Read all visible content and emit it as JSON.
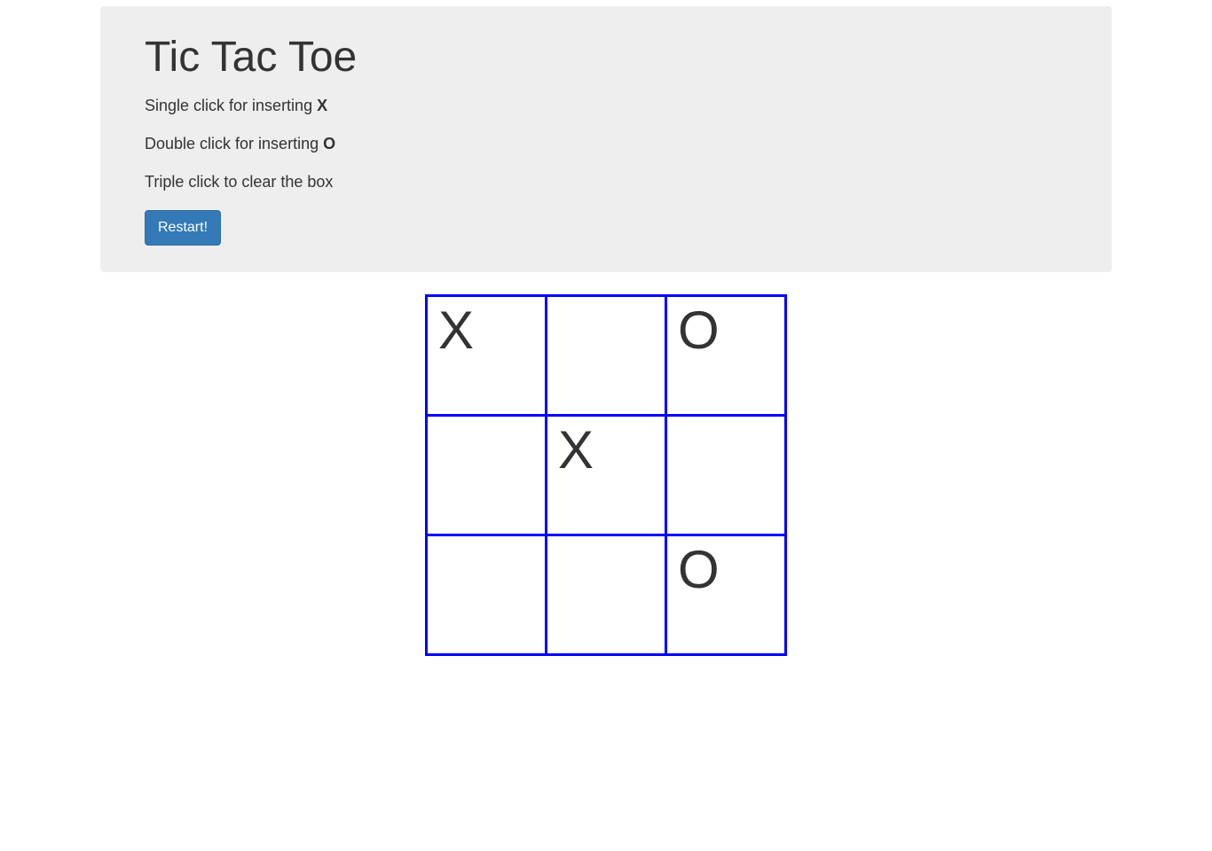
{
  "header": {
    "title": "Tic Tac Toe",
    "instruction1_prefix": "Single click for inserting ",
    "instruction1_bold": "X",
    "instruction2_prefix": "Double click for inserting ",
    "instruction2_bold": "O",
    "instruction3": "Triple click to clear the box",
    "restart_label": "Restart!"
  },
  "board": {
    "cells": [
      [
        "X",
        "",
        "O"
      ],
      [
        "",
        "X",
        ""
      ],
      [
        "",
        "",
        "O"
      ]
    ]
  }
}
